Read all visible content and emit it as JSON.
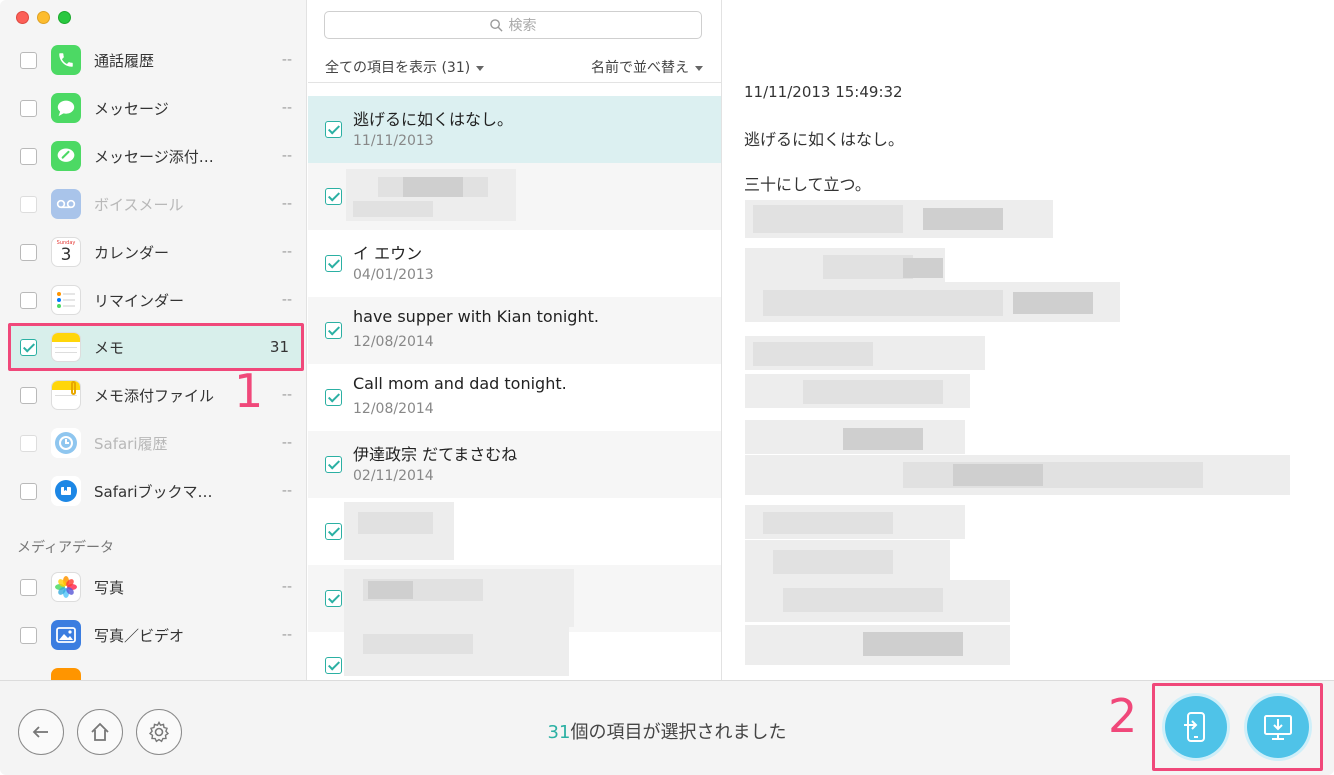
{
  "sidebar": {
    "items": [
      {
        "label": "通話履歴",
        "count": "--",
        "checked": false,
        "dim": false,
        "icon": "phone-icon",
        "color": "#4cd964"
      },
      {
        "label": "メッセージ",
        "count": "--",
        "checked": false,
        "dim": false,
        "icon": "message-icon",
        "color": "#4cd964"
      },
      {
        "label": "メッセージ添付…",
        "count": "--",
        "checked": false,
        "dim": false,
        "icon": "attachment-icon",
        "color": "#4cd964"
      },
      {
        "label": "ボイスメール",
        "count": "--",
        "checked": false,
        "dim": true,
        "icon": "voicemail-icon",
        "color": "#a9c4ea"
      },
      {
        "label": "カレンダー",
        "count": "--",
        "checked": false,
        "dim": false,
        "icon": "calendar-icon",
        "color": "#ffffff"
      },
      {
        "label": "リマインダー",
        "count": "--",
        "checked": false,
        "dim": false,
        "icon": "reminder-icon",
        "color": "#ffffff"
      },
      {
        "label": "メモ",
        "count": "31",
        "checked": true,
        "dim": false,
        "icon": "notes-icon",
        "color": "#ffd60a"
      },
      {
        "label": "メモ添付ファイル",
        "count": "--",
        "checked": false,
        "dim": false,
        "icon": "notes-attachment-icon",
        "color": "#ffd60a"
      },
      {
        "label": "Safari履歴",
        "count": "--",
        "checked": false,
        "dim": true,
        "icon": "safari-history-icon",
        "color": "#8fc6ef"
      },
      {
        "label": "Safariブックマ…",
        "count": "--",
        "checked": false,
        "dim": false,
        "icon": "safari-bookmark-icon",
        "color": "#1d87e5"
      }
    ],
    "media_title": "メディアデータ",
    "media_items": [
      {
        "label": "写真",
        "count": "--",
        "icon": "photos-icon"
      },
      {
        "label": "写真／ビデオ",
        "count": "--",
        "icon": "photo-video-icon",
        "color": "#3b7de0"
      }
    ],
    "calendar_day": "3",
    "calendar_weekday": "Sunday"
  },
  "list": {
    "search_placeholder": "検索",
    "filter_label": "全ての項目を表示 (31)",
    "sort_label": "名前で並べ替え",
    "notes": [
      {
        "title": "逃げるに如くはなし。",
        "date": "11/11/2013"
      },
      {
        "title": "イ エウン",
        "date": "04/01/2013"
      },
      {
        "title": "have supper with Kian tonight.",
        "date": "12/08/2014"
      },
      {
        "title": "Call mom and dad tonight.",
        "date": "12/08/2014"
      },
      {
        "title": "伊達政宗  だてまさむね",
        "date": "02/11/2014"
      }
    ]
  },
  "detail": {
    "timestamp": "11/11/2013 15:49:32",
    "line1": "逃げるに如くはなし。",
    "line2": "三十にして立つ。"
  },
  "bottom": {
    "selected_count": "31",
    "selected_suffix": "個の項目が選択されました"
  },
  "annotations": {
    "step1": "1",
    "step2": "2"
  },
  "colors": {
    "accent": "#2bb0a3",
    "highlight": "#f0487a",
    "action": "#4fc3e8"
  }
}
